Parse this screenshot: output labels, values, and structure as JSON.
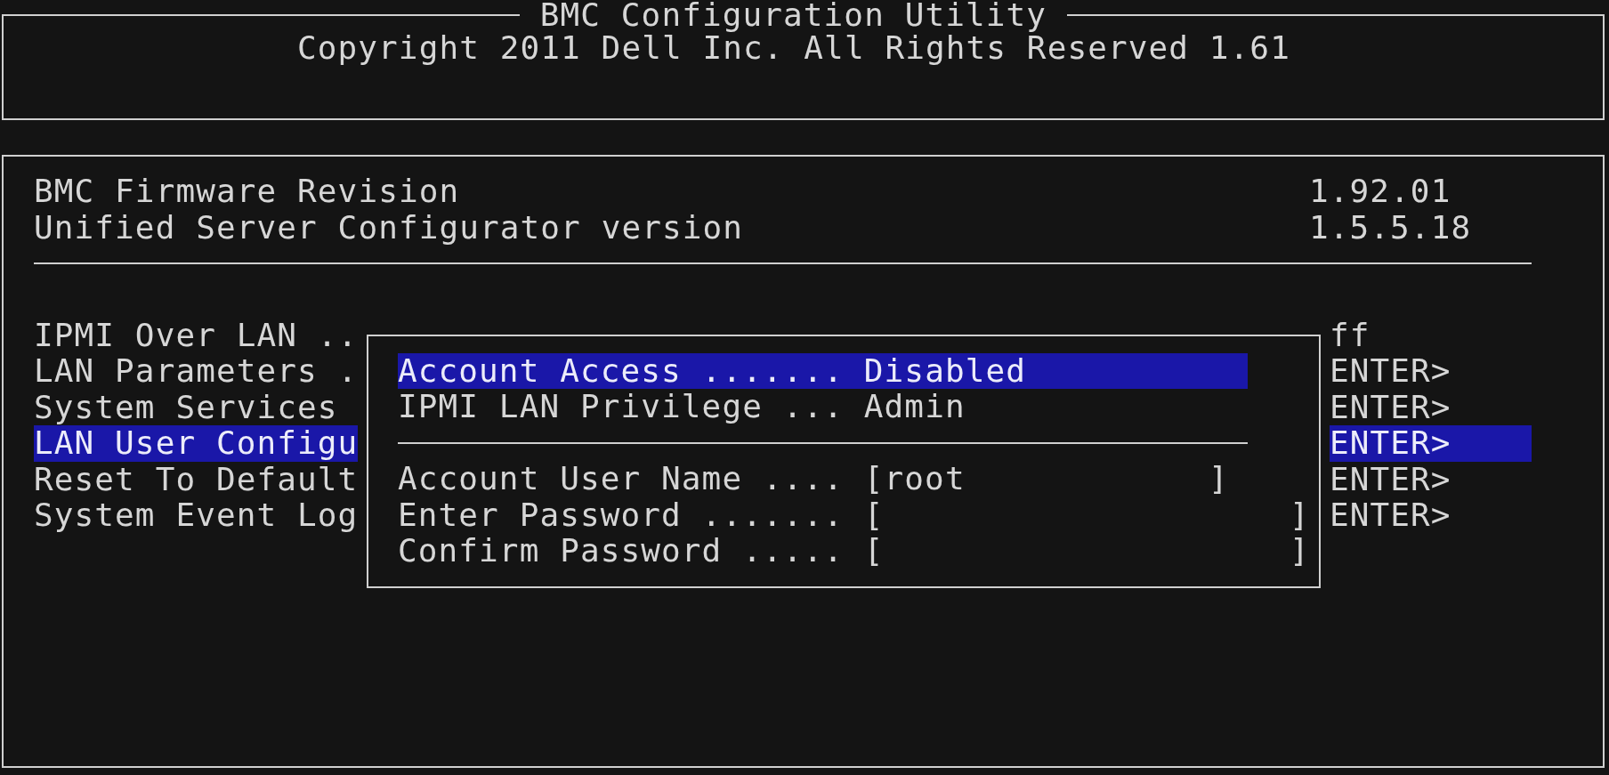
{
  "header": {
    "title": "BMC Configuration Utility",
    "copyright": "Copyright 2011 Dell Inc. All Rights Reserved 1.61"
  },
  "info": [
    {
      "label": "BMC Firmware Revision",
      "value": "1.92.01"
    },
    {
      "label": "Unified Server Configurator version",
      "value": "1.5.5.18"
    }
  ],
  "menu": [
    {
      "label": "IPMI Over LAN ..",
      "value": "ff",
      "selected": false
    },
    {
      "label": "LAN Parameters .",
      "value": "ENTER>",
      "selected": false
    },
    {
      "label": "System Services",
      "value": "ENTER>",
      "selected": false
    },
    {
      "label": "LAN User Configu",
      "value": "ENTER>",
      "selected": true
    },
    {
      "label": "Reset To Default",
      "value": "ENTER>",
      "selected": false
    },
    {
      "label": "System Event Log",
      "value": "ENTER>",
      "selected": false
    }
  ],
  "popup": {
    "options": [
      {
        "label": "Account Access .......",
        "value": "Disabled",
        "selected": true
      },
      {
        "label": "IPMI LAN Privilege ...",
        "value": "Admin",
        "selected": false
      }
    ],
    "fields": [
      {
        "kind": "text",
        "label": "Account User Name ....",
        "open": "[",
        "value": "root",
        "close": "]"
      },
      {
        "kind": "password",
        "label": "Enter Password .......",
        "open": "[",
        "close": "]"
      },
      {
        "kind": "password",
        "label": "Confirm Password .....",
        "open": "[",
        "close": "]"
      }
    ]
  }
}
